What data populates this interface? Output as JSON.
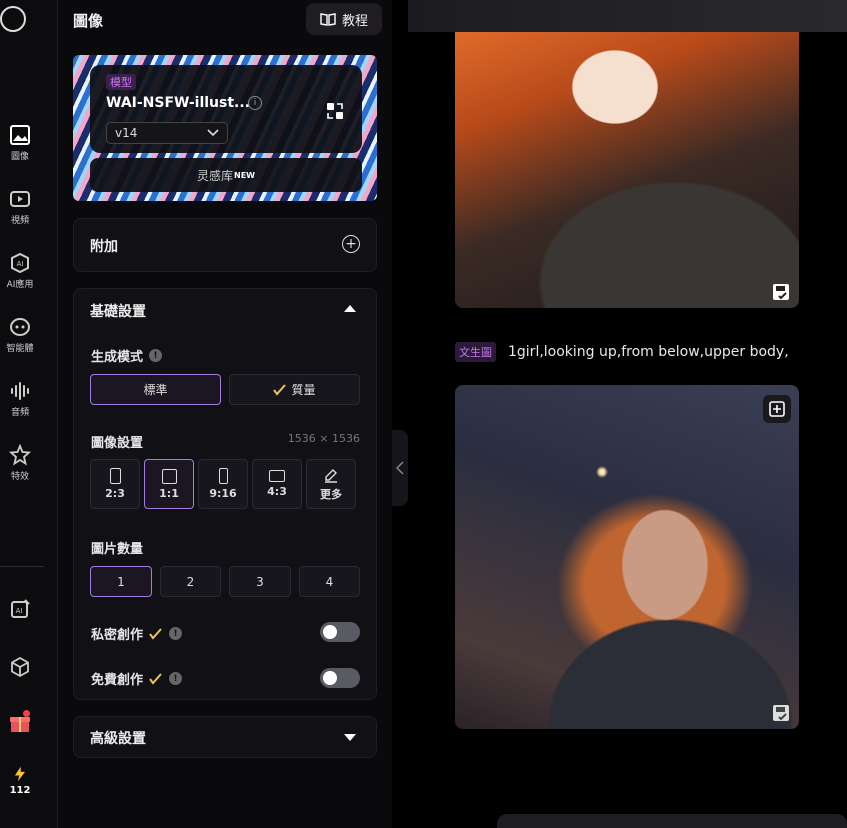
{
  "rail": {
    "items": [
      {
        "label": "圖像",
        "icon": "image-icon"
      },
      {
        "label": "視頻",
        "icon": "video-icon"
      },
      {
        "label": "AI應用",
        "icon": "ai-app-icon"
      },
      {
        "label": "智能體",
        "icon": "agent-icon"
      },
      {
        "label": "音頻",
        "icon": "audio-icon"
      },
      {
        "label": "特效",
        "icon": "effects-icon"
      }
    ],
    "credits": "112"
  },
  "panel": {
    "title": "圖像",
    "tutorial_label": "教程",
    "model": {
      "tag": "模型",
      "name": "WAI-NSFW-illust...",
      "version": "v14",
      "library_label": "灵感库",
      "library_badge": "NEW"
    },
    "addon": {
      "title": "附加"
    },
    "basic": {
      "title": "基礎設置",
      "mode_label": "生成模式",
      "modes": [
        {
          "label": "標準",
          "selected": true
        },
        {
          "label": "質量",
          "selected": false
        }
      ],
      "image_settings_label": "圖像設置",
      "dimensions": "1536 × 1536",
      "ratios": [
        {
          "label": "2:3",
          "selected": false
        },
        {
          "label": "1:1",
          "selected": true
        },
        {
          "label": "9:16",
          "selected": false
        },
        {
          "label": "4:3",
          "selected": false
        },
        {
          "label": "更多",
          "selected": false
        }
      ],
      "count_label": "圖片數量",
      "counts": [
        "1",
        "2",
        "3",
        "4"
      ],
      "count_selected": "1",
      "private_label": "私密創作",
      "private_on": false,
      "free_label": "免費創作",
      "free_on": false
    },
    "advanced": {
      "title": "高級設置"
    }
  },
  "main": {
    "prompt_badge": "文生圖",
    "prompt_text": "1girl,looking up,from below,upper body,"
  },
  "colors": {
    "accent": "#a57de0",
    "tag": "#c47ae8"
  }
}
